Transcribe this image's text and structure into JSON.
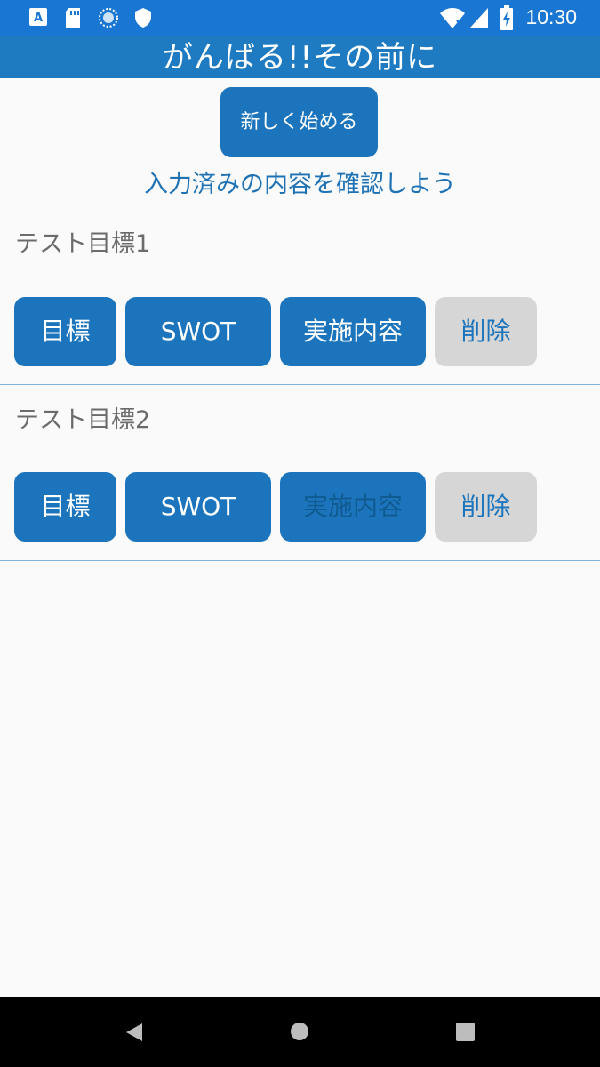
{
  "status_bar": {
    "time": "10:30",
    "left_icons": [
      "a-box-icon",
      "sd-card-icon",
      "sync-circle-icon",
      "shield-icon"
    ],
    "right_icons": [
      "wifi-icon",
      "signal-icon",
      "battery-icon"
    ],
    "color": "#1976d2"
  },
  "app": {
    "title": "がんばる!!その前に",
    "new_button_label": "新しく始める",
    "subtitle": "入力済みの内容を確認しよう",
    "accent_color": "#1c75bc"
  },
  "goals": [
    {
      "title": "テスト目標1",
      "buttons": {
        "goal": "目標",
        "swot": "SWOT",
        "plan": "実施内容",
        "delete": "削除"
      },
      "plan_enabled": true
    },
    {
      "title": "テスト目標2",
      "buttons": {
        "goal": "目標",
        "swot": "SWOT",
        "plan": "実施内容",
        "delete": "削除"
      },
      "plan_enabled": false
    }
  ],
  "nav": {
    "icons": [
      "back-icon",
      "home-icon",
      "recents-icon"
    ]
  }
}
